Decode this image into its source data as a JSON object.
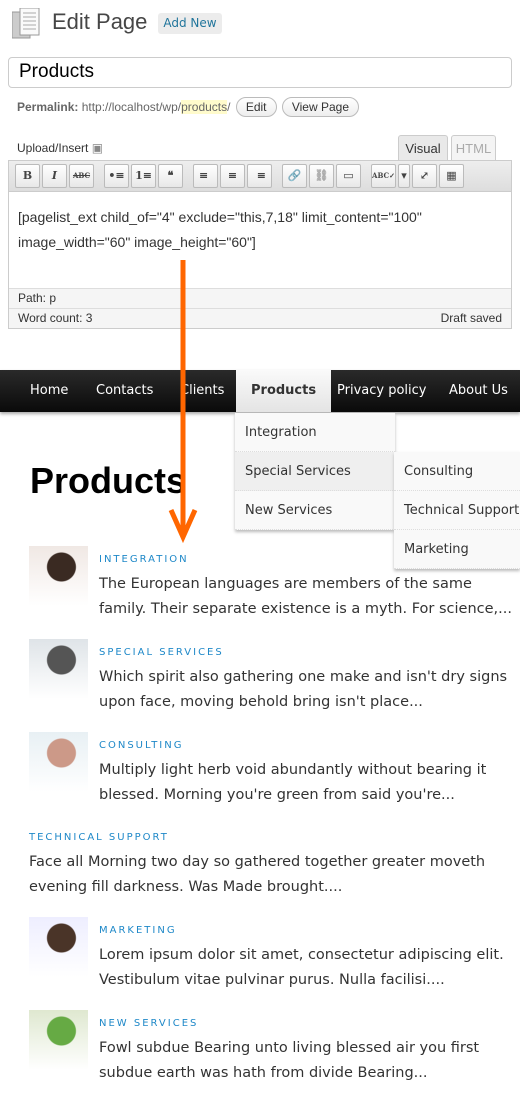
{
  "admin": {
    "title": "Edit Page",
    "add_new": "Add New",
    "post_title": "Products",
    "permalink_label": "Permalink:",
    "permalink_base": "http://localhost/wp/",
    "permalink_slug": "products",
    "permalink_end": "/",
    "edit_btn": "Edit",
    "view_btn": "View Page",
    "upload_label": "Upload/Insert",
    "tabs": [
      "Visual",
      "HTML"
    ],
    "toolbar": [
      "B",
      "I",
      "ABC",
      "•≡",
      "1≡",
      "❝",
      "≡",
      "≡",
      "≡",
      "🔗",
      "⛓",
      "▭",
      "ABC✓",
      "▾",
      "⤢",
      "▦"
    ],
    "content": "[pagelist_ext child_of=\"4\" exclude=\"this,7,18\" limit_content=\"100\" image_width=\"60\" image_height=\"60\"]",
    "path_label": "Path:",
    "path_value": "p",
    "word_count": "Word count: 3",
    "draft": "Draft saved"
  },
  "nav": {
    "items": [
      "Home",
      "Contacts",
      "Clients",
      "Products",
      "Privacy policy",
      "About Us"
    ],
    "dropdown": [
      "Integration",
      "Special Services",
      "New Services"
    ],
    "submenu": [
      "Consulting",
      "Technical Support",
      "Marketing"
    ]
  },
  "page": {
    "heading": "Products",
    "items": [
      {
        "cat": "INTEGRATION",
        "text": "The European languages are members of the same family. Their separate existence is a myth. For science,..."
      },
      {
        "cat": "SPECIAL SERVICES",
        "text": "Which spirit also gathering one make and isn't dry signs upon face, moving behold bring isn't place..."
      },
      {
        "cat": "CONSULTING",
        "text": "Multiply light herb void abundantly without bearing it blessed. Morning you're green from said you're..."
      },
      {
        "cat": "TECHNICAL SUPPORT",
        "text": "Face all Morning two day so gathered together greater moveth evening fill darkness. Was Made brought...."
      },
      {
        "cat": "MARKETING",
        "text": "Lorem ipsum dolor sit amet, consectetur adipiscing elit. Vestibulum vitae pulvinar purus. Nulla facilisi...."
      },
      {
        "cat": "NEW SERVICES",
        "text": "Fowl subdue Bearing unto living blessed air you first subdue earth was hath from divide Bearing..."
      }
    ]
  },
  "colors": {
    "accent": "#1e88c8",
    "arrow": "#ff6600",
    "nav": "#111111"
  }
}
